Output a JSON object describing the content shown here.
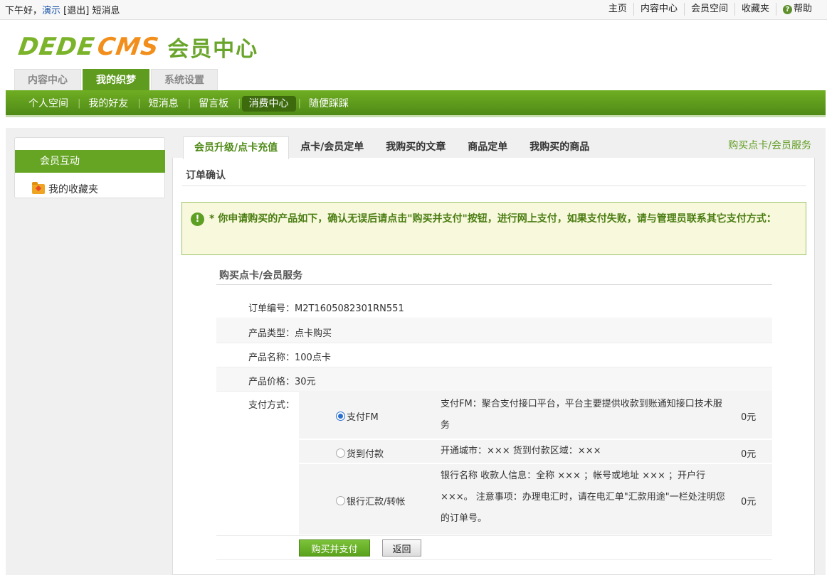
{
  "topbar": {
    "greeting": "下午好，",
    "username": "演示",
    "logout": "[退出]",
    "messages": "短消息",
    "links": [
      "主页",
      "内容中心",
      "会员空间",
      "收藏夹",
      "帮助"
    ]
  },
  "logo": {
    "part1": "DEDE",
    "part2": "CMS",
    "part3": "会员中心"
  },
  "main_tabs": [
    "内容中心",
    "我的织梦",
    "系统设置"
  ],
  "green_nav": [
    "个人空间",
    "我的好友",
    "短消息",
    "留言板",
    "消费中心",
    "随便踩踩"
  ],
  "sidebar": {
    "active": "会员互动",
    "item": "我的收藏夹"
  },
  "sub_tabs": [
    "会员升级/点卡充值",
    "点卡/会员定单",
    "我购买的文章",
    "商品定单",
    "我购买的商品"
  ],
  "top_right_link": "购买点卡/会员服务",
  "section_title": "订单确认",
  "notice": "* 你申请购买的产品如下，确认无误后请点击\"购买并支付\"按钮，进行网上支付，如果支付失败，请与管理员联系其它支付方式：",
  "buy_title": "购买点卡/会员服务",
  "order": {
    "order_no": "订单编号：M2T1605082301RN551",
    "type": "产品类型：点卡购买",
    "name": "产品名称：100点卡",
    "price": "产品价格：30元"
  },
  "payment": {
    "label": "支付方式：",
    "options": [
      {
        "name": "支付FM",
        "desc": "支付FM：聚合支付接口平台，平台主要提供收款到账通知接口技术服务",
        "amount": "0元",
        "checked": true
      },
      {
        "name": "货到付款",
        "desc": "开通城市：××× 货到付款区域：×××",
        "amount": "0元",
        "checked": false
      },
      {
        "name": "银行汇款/转帐",
        "desc": "银行名称 收款人信息：全称 ××× ；帐号或地址 ××× ；开户行 ×××。 注意事项：办理电汇时，请在电汇单\"汇款用途\"一栏处注明您的订单号。",
        "amount": "0元",
        "checked": false
      }
    ]
  },
  "buttons": {
    "buy": "购买并支付",
    "back": "返回"
  }
}
